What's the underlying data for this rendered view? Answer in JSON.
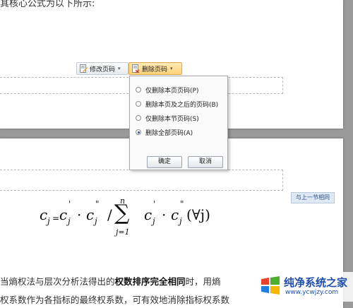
{
  "document": {
    "top_text": "其核心公式为以下所示:",
    "body_line1_prefix": "当熵权法与层次分析法得出的",
    "body_line1_bold": "权数排序完全相同",
    "body_line1_suffix": "时，用熵",
    "body_line2": "权系数作为各指标的最终权系数，可有效地消除指标权系数"
  },
  "toolbar": {
    "edit_page_number_label": "修改页码",
    "delete_page_number_label": "删除页码"
  },
  "delete_menu": {
    "options": [
      {
        "label": "仅删除本页页码(P)",
        "selected": false
      },
      {
        "label": "删除本页及之后的页码(B)",
        "selected": false
      },
      {
        "label": "仅删除本节页码(S)",
        "selected": false
      },
      {
        "label": "删除全部页码(A)",
        "selected": true
      }
    ],
    "ok_label": "确定",
    "cancel_label": "取消"
  },
  "header": {
    "same_as_previous_label": "与上一节相同"
  },
  "formula": {
    "lhs": "c",
    "lhs_sub": "j",
    "eq": "=",
    "sum_top": "n",
    "sum_bottom": "j=1",
    "forall": "(∀j)"
  },
  "watermark": {
    "title": "纯净系统之家",
    "url": "www.ycwjzy.com"
  },
  "colors": {
    "menu_highlight": "#ffd37a",
    "watermark_blue": "#1f4fae",
    "tag_blue": "#2b4f82"
  }
}
